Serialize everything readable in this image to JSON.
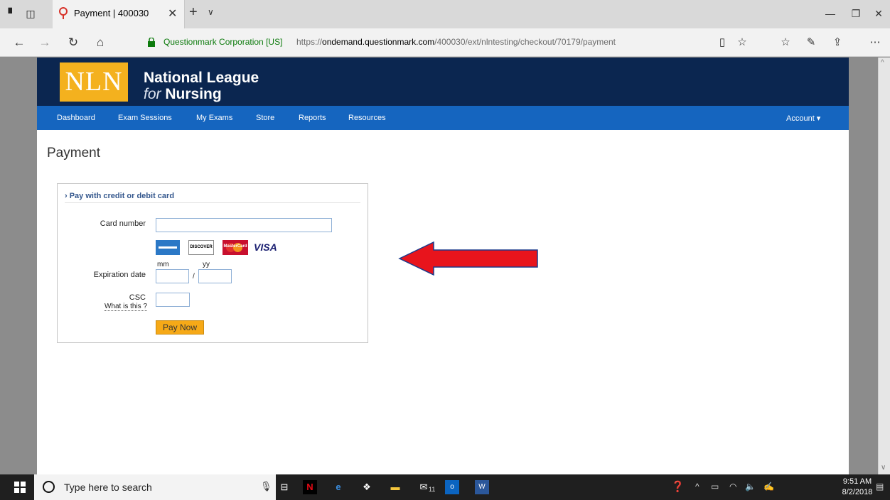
{
  "browser": {
    "tab_title": "Payment | 400030",
    "identity": "Questionmark Corporation [US]",
    "url_prefix": "https://",
    "url_host": "ondemand.questionmark.com",
    "url_path": "/400030/ext/nlntesting/checkout/70179/payment"
  },
  "site": {
    "logo_text": "NLN",
    "org_line1": "National League",
    "org_for": "for",
    "org_nursing": "Nursing",
    "menu": [
      "Dashboard",
      "Exam Sessions",
      "My Exams",
      "Store",
      "Reports",
      "Resources"
    ],
    "account": "Account ▾"
  },
  "page": {
    "title": "Payment",
    "panel_heading": "› Pay with credit or debit card",
    "card_number_label": "Card number",
    "card_number_value": "",
    "card_brands": [
      "DISCOVER",
      "MasterCard",
      "VISA"
    ],
    "mm_label": "mm",
    "yy_label": "yy",
    "expiration_label": "Expiration date",
    "slash": "/",
    "csc_label": "CSC",
    "csc_help": "What is this ?",
    "pay_button": "Pay Now"
  },
  "annotation": {
    "arrow_color": "#e8141c"
  },
  "taskbar": {
    "search_placeholder": "Type here to search",
    "time": "9:51 AM",
    "date": "8/2/2018",
    "mail_badge": "11"
  }
}
